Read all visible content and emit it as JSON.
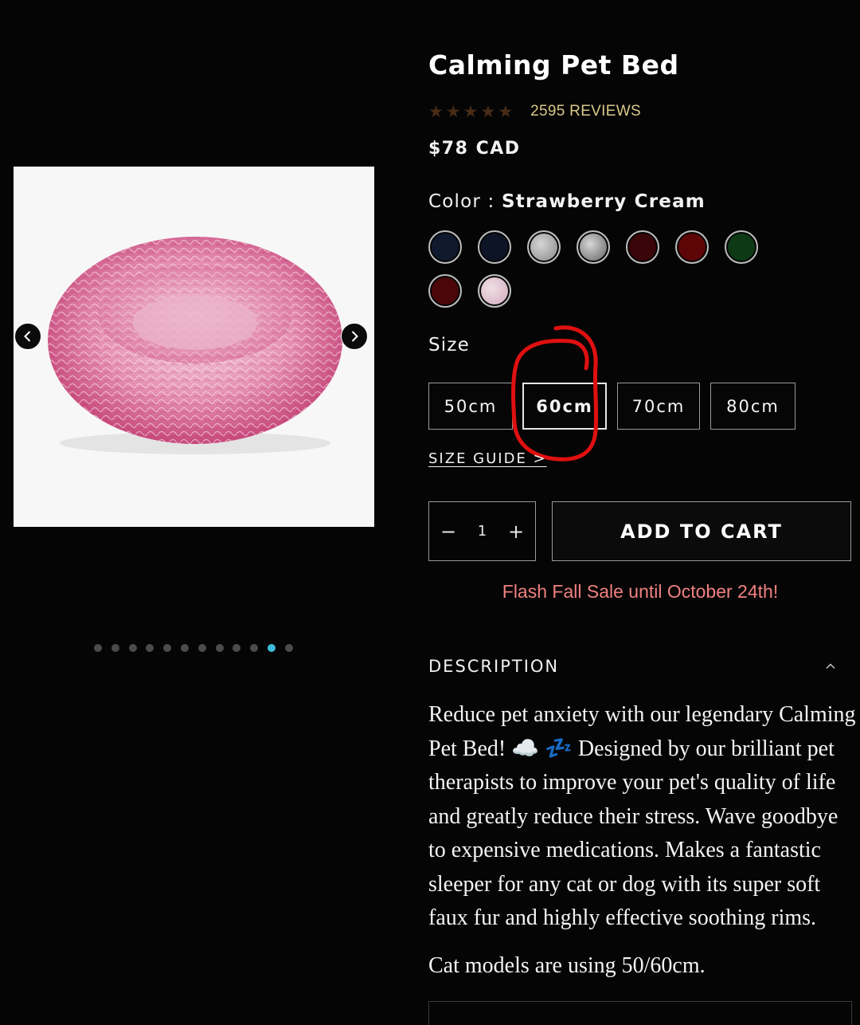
{
  "product": {
    "title": "Calming Pet Bed",
    "reviews": "2595 REVIEWS",
    "rating_value": 0,
    "rating_max": 5,
    "price": "$78 CAD"
  },
  "color": {
    "label": "Color : ",
    "selected": "Strawberry Cream",
    "swatches": [
      {
        "name": "navy-1",
        "fill": "#0f1a2e"
      },
      {
        "name": "navy-2",
        "fill": "#0c1426"
      },
      {
        "name": "grey-1",
        "fill": "#9a9a9a"
      },
      {
        "name": "grey-2",
        "fill": "#7d7d7d"
      },
      {
        "name": "wine-1",
        "fill": "#3a0508"
      },
      {
        "name": "wine-2",
        "fill": "#5e0508"
      },
      {
        "name": "green",
        "fill": "#0d3a14"
      },
      {
        "name": "burgundy",
        "fill": "#4a0608"
      },
      {
        "name": "strawberry-cream",
        "fill": "#d8b7c4"
      }
    ]
  },
  "size": {
    "label": "Size",
    "options": [
      "50cm",
      "60cm",
      "70cm",
      "80cm"
    ],
    "selected": "60cm"
  },
  "size_guide": "SIZE GUIDE >",
  "quantity": {
    "minus": "−",
    "value": "1",
    "plus": "+"
  },
  "add_to_cart": "ADD TO CART",
  "flash_sale": "Flash Fall Sale until October 24th!",
  "description": {
    "title": "DESCRIPTION",
    "body": "Reduce pet anxiety with our legendary Calming Pet Bed! ☁️ 💤 Designed by our brilliant pet therapists to improve your pet's quality of life and greatly reduce their stress. Wave goodbye to expensive medications. Makes a fantastic sleeper for any cat or dog with its super soft faux fur and highly effective soothing rims.",
    "note": "Cat models are using 50/60cm."
  },
  "gallery": {
    "dot_count": 12,
    "active_dot": 11
  },
  "colors": {
    "accent_dot": "#3fbcd9",
    "flash_text": "#f08080",
    "reviews_text": "#d9c88a",
    "annotation": "#e01010"
  }
}
